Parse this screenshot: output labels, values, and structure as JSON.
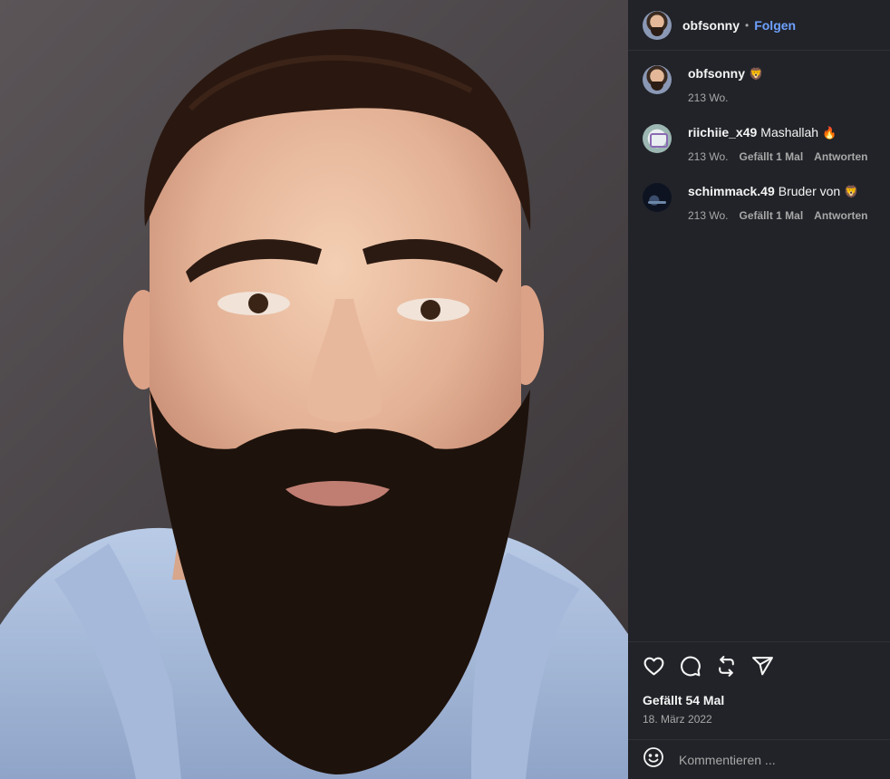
{
  "post": {
    "author": "obfsonny",
    "follow_label": "Folgen",
    "separator": "•"
  },
  "comments": [
    {
      "user": "obfsonny",
      "text": "",
      "emoji": "🦁",
      "age": "213 Wo.",
      "likes": "",
      "reply": ""
    },
    {
      "user": "riichiie_x49",
      "text": "Mashallah",
      "emoji": "🔥",
      "age": "213 Wo.",
      "likes": "Gefällt 1 Mal",
      "reply": "Antworten"
    },
    {
      "user": "schimmack.49",
      "text": "Bruder von",
      "emoji": "🦁",
      "age": "213 Wo.",
      "likes": "Gefällt 1 Mal",
      "reply": "Antworten"
    }
  ],
  "actions": {
    "like_count": "Gefällt 54 Mal",
    "date": "18. März 2022"
  },
  "comment_box": {
    "placeholder": "Kommentieren ..."
  },
  "colors": {
    "panel_bg": "#212328",
    "link_blue": "#6ea0ff",
    "muted_text": "#a8a8a8"
  }
}
